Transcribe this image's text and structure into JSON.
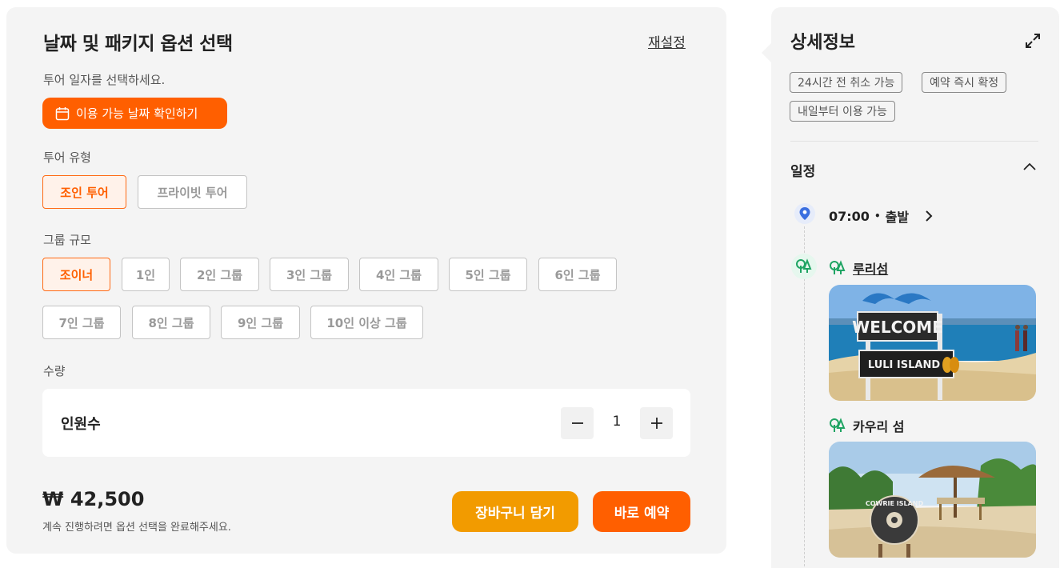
{
  "left": {
    "title": "날짜 및 패키지 옵션 선택",
    "reset_label": "재설정",
    "date_prompt": "투어 일자를 선택하세요.",
    "date_button_label": "이용 가능 날짜 확인하기",
    "tour_type_label": "투어 유형",
    "tour_types": [
      "조인 투어",
      "프라이빗 투어"
    ],
    "group_size_label": "그룹 규모",
    "group_sizes": [
      "조이너",
      "1인",
      "2인 그룹",
      "3인 그룹",
      "4인 그룹",
      "5인 그룹",
      "6인 그룹",
      "7인 그룹",
      "8인 그룹",
      "9인 그룹",
      "10인 이상 그룹"
    ],
    "quantity_label": "수량",
    "quantity_row_label": "인원수",
    "quantity_value": "1",
    "price": "₩ 42,500",
    "price_note": "계속 진행하려면 옵션 선택을 완료해주세요.",
    "cart_button": "장바구니 담기",
    "book_button": "바로 예약"
  },
  "right": {
    "title": "상세정보",
    "tags": [
      "24시간 전 취소 가능",
      "예약 즉시 확정",
      "내일부터 이용 가능"
    ],
    "schedule_title": "일정",
    "departure_time": "07:00",
    "departure_sep": "•",
    "departure_label": "출발",
    "places": [
      "루리섬",
      "카우리 섬"
    ],
    "photo1_sign_top": "WELCOME",
    "photo1_sign_bottom": "LULI ISLAND",
    "photo2_sign": "COWRIE ISLAND"
  },
  "colors": {
    "accent": "#ff5f00",
    "cart": "#f29b00",
    "panel_bg": "#f4f4f4",
    "green_icon": "#1fa463",
    "pin_blue": "#3b6fe0"
  }
}
